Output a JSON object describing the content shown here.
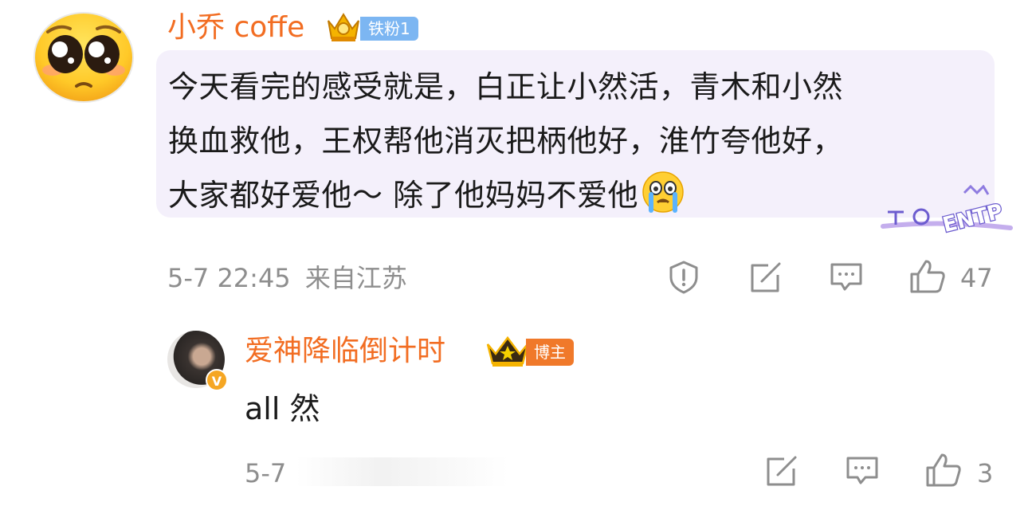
{
  "comment": {
    "username": "小乔 coffe",
    "fan_badge": "铁粉1",
    "text_lines": [
      "今天看完的感受就是，白正让小然活，青木和小然",
      "换血救他，王权帮他消灭把柄他好，淮竹夸他好，",
      "大家都好爱他～ 除了他妈妈不爱他"
    ],
    "sticker_text": "ENTP",
    "timestamp": "5-7 22:45",
    "location": "来自江苏",
    "like_count": "47",
    "icons": [
      "report-icon",
      "share-icon",
      "comment-icon",
      "like-icon",
      "crying-emoji-icon"
    ]
  },
  "reply": {
    "username": "爱神降临倒计时",
    "role_badge": "博主",
    "verified_mark": "V",
    "text": "all 然",
    "timestamp": "5-7",
    "like_count": "3",
    "icons": [
      "share-icon",
      "comment-icon",
      "like-icon"
    ]
  },
  "colors": {
    "username": "#f26d22",
    "fan_badge_bg": "#7cb6f2",
    "blogger_badge_bg": "#f0792a",
    "bubble_bg": "#f4f0fb",
    "meta_text": "#8e8e8e"
  }
}
